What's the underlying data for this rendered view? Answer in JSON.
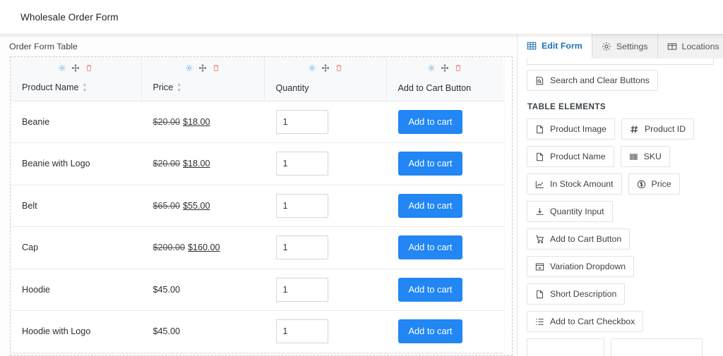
{
  "topbar": {
    "title": "Wholesale Order Form"
  },
  "canvas": {
    "section_label": "Order Form Table",
    "section_gear_icon": "gear-icon"
  },
  "table": {
    "columns": [
      {
        "label": "Product Name",
        "sortable": true
      },
      {
        "label": "Price",
        "sortable": true
      },
      {
        "label": "Quantity",
        "sortable": false
      },
      {
        "label": "Add to Cart Button",
        "sortable": false
      }
    ],
    "column_tools": [
      "gear-icon",
      "move-icon",
      "trash-icon"
    ],
    "rows": [
      {
        "name": "Beanie",
        "price_old": "$20.00",
        "price_new": "$18.00",
        "qty": "1",
        "atc": "Add to cart"
      },
      {
        "name": "Beanie with Logo",
        "price_old": "$20.00",
        "price_new": "$18.00",
        "qty": "1",
        "atc": "Add to cart"
      },
      {
        "name": "Belt",
        "price_old": "$65.00",
        "price_new": "$55.00",
        "qty": "1",
        "atc": "Add to cart"
      },
      {
        "name": "Cap",
        "price_old": "$200.00",
        "price_new": "$160.00",
        "qty": "1",
        "atc": "Add to cart"
      },
      {
        "name": "Hoodie",
        "price_old": "",
        "price_new": "$45.00",
        "qty": "1",
        "atc": "Add to cart"
      },
      {
        "name": "Hoodie with Logo",
        "price_old": "",
        "price_new": "$45.00",
        "qty": "1",
        "atc": "Add to cart"
      }
    ]
  },
  "sidebar": {
    "tabs": [
      {
        "label": "Edit Form",
        "icon": "table-grid-icon",
        "active": true
      },
      {
        "label": "Settings",
        "icon": "gear-icon",
        "active": false
      },
      {
        "label": "Locations",
        "icon": "layout-icon",
        "active": false
      }
    ],
    "search_clear": {
      "label": "Search and Clear Buttons",
      "icon": "search-document-icon"
    },
    "group_title": "TABLE ELEMENTS",
    "elements": [
      {
        "label": "Product Image",
        "icon": "document-icon"
      },
      {
        "label": "Product ID",
        "icon": "hash-icon"
      },
      {
        "label": "Product Name",
        "icon": "document-icon"
      },
      {
        "label": "SKU",
        "icon": "barcode-icon"
      },
      {
        "label": "In Stock Amount",
        "icon": "chart-line-icon"
      },
      {
        "label": "Price",
        "icon": "dollar-circle-icon"
      },
      {
        "label": "Quantity Input",
        "icon": "download-input-icon"
      },
      {
        "label": "Add to Cart Button",
        "icon": "cart-icon"
      },
      {
        "label": "Variation Dropdown",
        "icon": "dropdown-icon"
      },
      {
        "label": "Short Description",
        "icon": "document-icon"
      },
      {
        "label": "Add to Cart Checkbox",
        "icon": "list-icon"
      }
    ]
  },
  "colors": {
    "accent_blue": "#2286f5",
    "tab_active": "#2271b1",
    "tool_gear": "#73b0d8",
    "tool_trash": "#e88a8a"
  }
}
